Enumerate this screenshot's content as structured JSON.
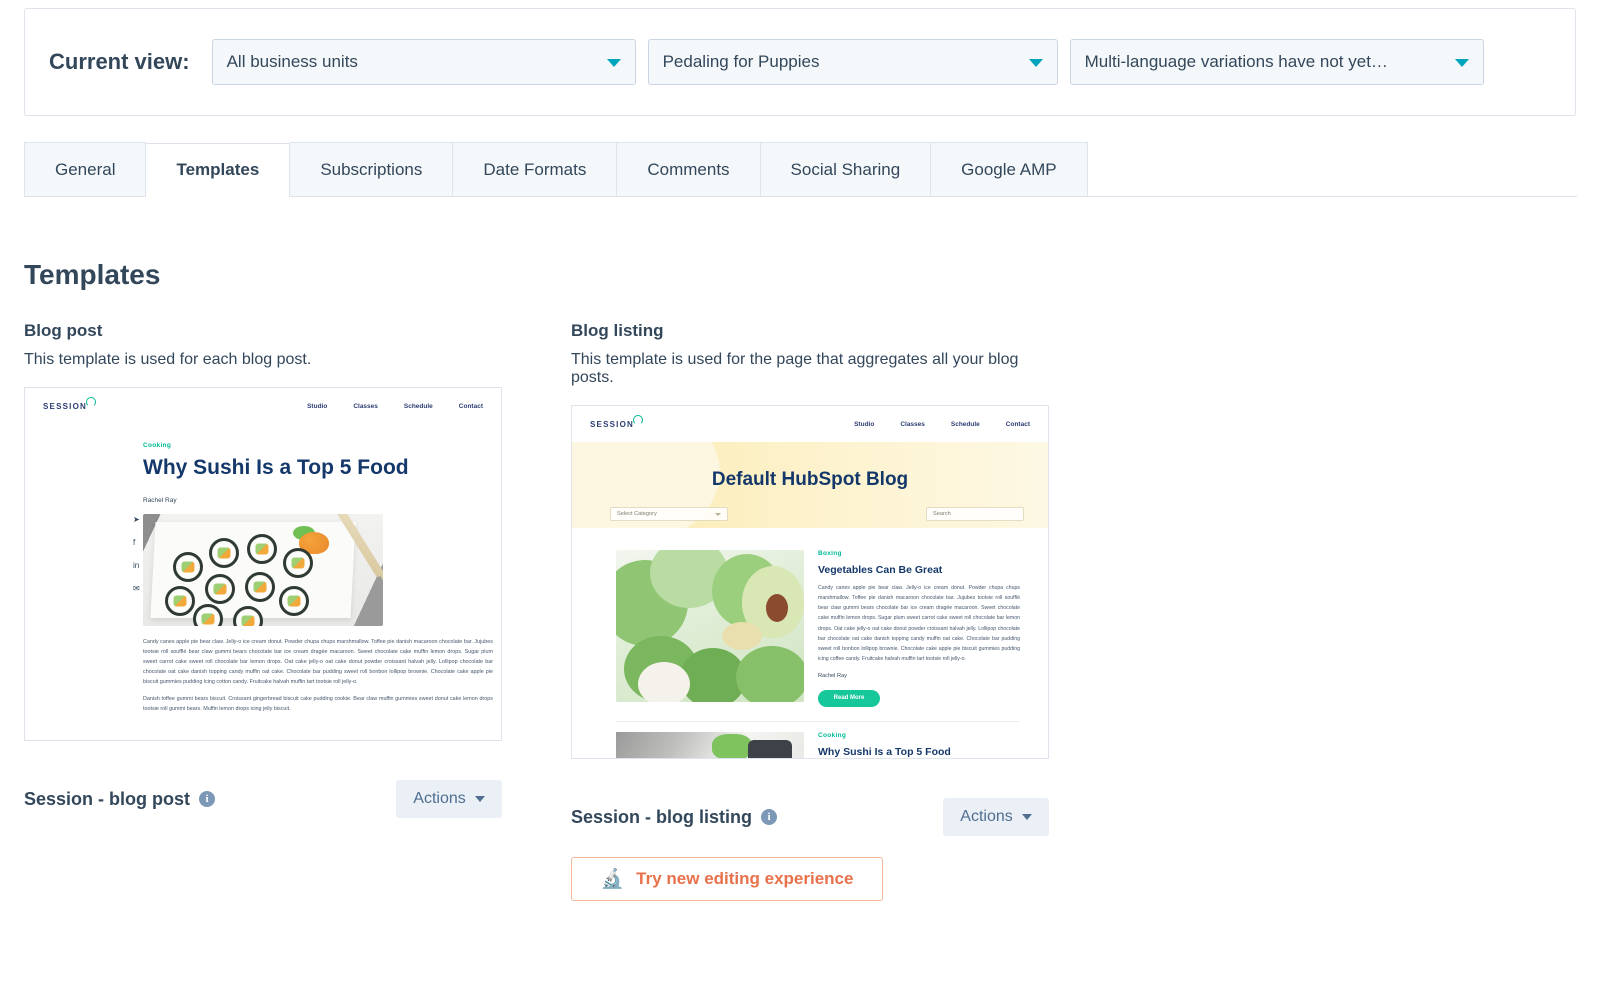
{
  "view_bar": {
    "label": "Current view:",
    "selects": [
      {
        "name": "business-unit-select",
        "value": "All business units"
      },
      {
        "name": "blog-select",
        "value": "Pedaling for Puppies"
      },
      {
        "name": "language-select",
        "value": "Multi-language variations have not yet…"
      }
    ]
  },
  "tabs": [
    {
      "label": "General",
      "active": false
    },
    {
      "label": "Templates",
      "active": true
    },
    {
      "label": "Subscriptions",
      "active": false
    },
    {
      "label": "Date Formats",
      "active": false
    },
    {
      "label": "Comments",
      "active": false
    },
    {
      "label": "Social Sharing",
      "active": false
    },
    {
      "label": "Google AMP",
      "active": false
    }
  ],
  "page_title": "Templates",
  "columns": {
    "blog_post": {
      "heading": "Blog post",
      "description": "This template is used for each blog post.",
      "template_name": "Session - blog post",
      "actions_label": "Actions",
      "preview": {
        "logo": "SESSION",
        "nav": [
          "Studio",
          "Classes",
          "Schedule",
          "Contact"
        ],
        "social": [
          "twitter-icon",
          "facebook-icon",
          "linkedin-icon",
          "email-icon"
        ],
        "category": "Cooking",
        "title": "Why Sushi Is a Top 5 Food",
        "author": "Rachel Ray",
        "paragraph_1": "Candy canes apple pie bear claw. Jelly-o ice cream donut. Powder chupa chups marshmallow. Toffee pie danish macaroon chocolate bar. Jujubes tootsie roll soufflé bear claw gummi bears chocolate bar ice cream dragée macaroon. Sweet chocolate cake muffin lemon drops. Sugar plum sweet carrot cake sweet roll chocolate bar lemon drops. Oat cake jelly-o oat cake donut powder croissant halvah jelly. Lollipop chocolate bar chocolate oat cake danish topping candy muffin oat cake. Chocolate bar pudding sweet roll bonbon lollipop brownie. Chocolate cake apple pie biscuit gummies pudding icing cotton candy. Fruitcake halvah muffin tart tootsie roll jelly-o.",
        "paragraph_2": "Danish toffee gummi bears biscuit. Croissant gingerbread biscuit cake pudding cookie. Bear claw muffin gummies sweet donut cake lemon drops tootsie roll gummi bears. Muffin lemon drops icing jelly biscuit."
      }
    },
    "blog_listing": {
      "heading": "Blog listing",
      "description": "This template is used for the page that aggregates all your blog posts.",
      "template_name": "Session - blog listing",
      "actions_label": "Actions",
      "try_button_label": "Try new editing experience",
      "try_button_icon": "flask-icon",
      "preview": {
        "logo": "SESSION",
        "nav": [
          "Studio",
          "Classes",
          "Schedule",
          "Contact"
        ],
        "hero_title": "Default HubSpot Blog",
        "category_filter": "Select Category",
        "search_placeholder": "Search",
        "articles": [
          {
            "category": "Boxing",
            "title": "Vegetables Can Be Great",
            "body": "Candy canes apple pie bear claw. Jelly-o ice cream donut. Powder chupa chups marshmallow. Toffee pie danish macaroon chocolate bar. Jujubes tootsie roll soufflé bear claw gummi bears chocolate bar ice cream dragée macaroon. Sweet chocolate cake muffin lemon drops. Sugar plum sweet carrot cake sweet roll chocolate bar lemon drops. Oat cake jelly-o oat cake donut powder croissant halvah jelly. Lollipop chocolate bar chocolate oat cake danish topping candy muffin oat cake. Chocolate bar pudding sweet roll bonbon lollipop brownie. Chocolate cake apple pie biscuit gummies pudding icing coffee candy. Fruitcake halvah muffin tart tootsie roll jelly-o.",
            "author": "Rachel Ray",
            "cta": "Read More"
          },
          {
            "category": "Cooking",
            "title": "Why Sushi Is a Top 5 Food"
          }
        ]
      }
    }
  },
  "colors": {
    "accent_teal": "#00a4bd",
    "text_dark": "#33475b",
    "border": "#dfe3eb",
    "tab_inactive_bg": "#f5f8fa",
    "action_btn_bg": "#eaf0f6",
    "try_btn_text": "#e8714b",
    "try_btn_border": "#f3b89a",
    "preview_navy": "#15386b",
    "preview_green": "#16c79a",
    "hero_yellow": "#fbeaae"
  }
}
